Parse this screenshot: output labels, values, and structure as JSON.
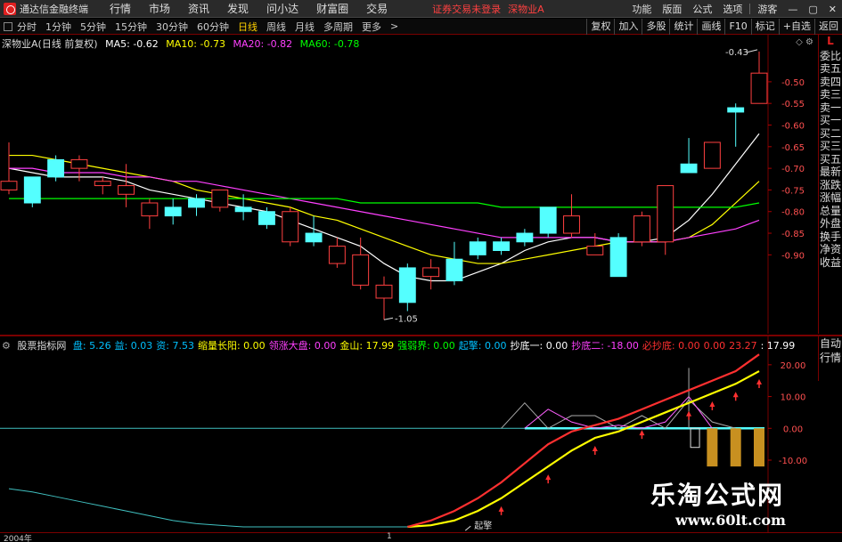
{
  "titlebar": {
    "app_title": "通达信金融终端",
    "menu": [
      "行情",
      "市场",
      "资讯",
      "发现",
      "问小达",
      "财富圈",
      "交易"
    ],
    "notice": "证券交易未登录",
    "stock": "深物业A",
    "right_menu": [
      "功能",
      "版面",
      "公式",
      "选项",
      "游客"
    ]
  },
  "toolbar": {
    "periods": [
      "分时",
      "1分钟",
      "5分钟",
      "15分钟",
      "30分钟",
      "60分钟",
      "日线",
      "周线",
      "月线",
      "多周期",
      "更多"
    ],
    "active_period": "日线",
    "right_buttons": [
      "复权",
      "加入",
      "多股",
      "统计",
      "画线",
      "F10",
      "标记",
      "+自选",
      "返回"
    ]
  },
  "main_legend": {
    "stock_label": "深物业A(日线 前复权)",
    "ma5": "MA5: -0.62",
    "ma10": "MA10: -0.73",
    "ma20": "MA20: -0.82",
    "ma60": "MA60: -0.78",
    "colors": {
      "ma5": "#ffffff",
      "ma10": "#ffff00",
      "ma20": "#ff40ff",
      "ma60": "#00ff00"
    }
  },
  "right_tabs": {
    "top": "L",
    "items": [
      "委比",
      "卖五",
      "卖四",
      "卖三",
      "卖一",
      "买一",
      "买二",
      "买三",
      "买五",
      "最新",
      "涨跌",
      "涨幅",
      "总量",
      "外盘",
      "换手",
      "净资",
      "收益"
    ],
    "sub_items": [
      "自动",
      "行情"
    ]
  },
  "sub_legend": {
    "name": "股票指标网",
    "items": [
      {
        "label": "盘: 5.26",
        "color": "#00c0ff"
      },
      {
        "label": "益: 0.03",
        "color": "#00c0ff"
      },
      {
        "label": "资: 7.53",
        "color": "#00c0ff"
      },
      {
        "label": "缩量长阳: 0.00",
        "color": "#ffff00"
      },
      {
        "label": "领涨大盘: 0.00",
        "color": "#ff40ff"
      },
      {
        "label": "金山: 17.99",
        "color": "#ffff00"
      },
      {
        "label": "强弱界: 0.00",
        "color": "#00ff00"
      },
      {
        "label": "起擎: 0.00",
        "color": "#00c0ff"
      },
      {
        "label": "抄底一: 0.00",
        "color": "#ffffff"
      },
      {
        "label": "抄底二: -18.00",
        "color": "#ff40ff"
      },
      {
        "label": "必抄底: 0.00",
        "color": "#ff3030"
      },
      {
        "label": "0.00",
        "color": "#ff3030"
      },
      {
        "label": "23.27",
        "color": "#ff3030"
      },
      {
        "label": ": 17.99",
        "color": "#ffffff"
      }
    ]
  },
  "chart_data": [
    {
      "type": "candlestick",
      "title": "深物业A(日线 前复权)",
      "y_ticks": [
        -0.5,
        -0.55,
        -0.6,
        -0.65,
        -0.7,
        -0.75,
        -0.8,
        -0.85,
        -0.9
      ],
      "ylim": [
        -1.07,
        -0.42
      ],
      "annotations": [
        {
          "label": "-0.43"
        },
        {
          "label": "-1.05"
        }
      ],
      "candles": [
        {
          "o": -0.75,
          "c": -0.73,
          "h": -0.64,
          "l": -0.76
        },
        {
          "o": -0.72,
          "c": -0.78,
          "h": -0.72,
          "l": -0.79
        },
        {
          "o": -0.68,
          "c": -0.72,
          "h": -0.67,
          "l": -0.73
        },
        {
          "o": -0.7,
          "c": -0.68,
          "h": -0.67,
          "l": -0.73
        },
        {
          "o": -0.74,
          "c": -0.73,
          "h": -0.72,
          "l": -0.76
        },
        {
          "o": -0.76,
          "c": -0.74,
          "h": -0.69,
          "l": -0.79
        },
        {
          "o": -0.81,
          "c": -0.78,
          "h": -0.77,
          "l": -0.84
        },
        {
          "o": -0.79,
          "c": -0.81,
          "h": -0.77,
          "l": -0.83
        },
        {
          "o": -0.77,
          "c": -0.79,
          "h": -0.76,
          "l": -0.81
        },
        {
          "o": -0.79,
          "c": -0.75,
          "h": -0.75,
          "l": -0.8
        },
        {
          "o": -0.79,
          "c": -0.8,
          "h": -0.76,
          "l": -0.82
        },
        {
          "o": -0.8,
          "c": -0.83,
          "h": -0.79,
          "l": -0.84
        },
        {
          "o": -0.87,
          "c": -0.8,
          "h": -0.79,
          "l": -0.88
        },
        {
          "o": -0.85,
          "c": -0.87,
          "h": -0.81,
          "l": -0.88
        },
        {
          "o": -0.92,
          "c": -0.88,
          "h": -0.86,
          "l": -0.93
        },
        {
          "o": -0.97,
          "c": -0.9,
          "h": -0.86,
          "l": -0.98
        },
        {
          "o": -1.0,
          "c": -0.97,
          "h": -0.95,
          "l": -1.05
        },
        {
          "o": -0.93,
          "c": -1.01,
          "h": -0.92,
          "l": -1.03
        },
        {
          "o": -0.95,
          "c": -0.93,
          "h": -0.91,
          "l": -0.98
        },
        {
          "o": -0.91,
          "c": -0.96,
          "h": -0.87,
          "l": -0.97
        },
        {
          "o": -0.87,
          "c": -0.9,
          "h": -0.86,
          "l": -0.91
        },
        {
          "o": -0.87,
          "c": -0.89,
          "h": -0.86,
          "l": -0.9
        },
        {
          "o": -0.85,
          "c": -0.87,
          "h": -0.84,
          "l": -0.88
        },
        {
          "o": -0.79,
          "c": -0.85,
          "h": -0.79,
          "l": -0.86
        },
        {
          "o": -0.85,
          "c": -0.81,
          "h": -0.76,
          "l": -0.86
        },
        {
          "o": -0.9,
          "c": -0.88,
          "h": -0.85,
          "l": -0.9
        },
        {
          "o": -0.86,
          "c": -0.95,
          "h": -0.85,
          "l": -0.95
        },
        {
          "o": -0.87,
          "c": -0.81,
          "h": -0.8,
          "l": -0.88
        },
        {
          "o": -0.87,
          "c": -0.74,
          "h": -0.74,
          "l": -0.9
        },
        {
          "o": -0.69,
          "c": -0.71,
          "h": -0.63,
          "l": -0.71
        },
        {
          "o": -0.7,
          "c": -0.64,
          "h": -0.64,
          "l": -0.7
        },
        {
          "o": -0.56,
          "c": -0.57,
          "h": -0.55,
          "l": -0.65
        },
        {
          "o": -0.55,
          "c": -0.48,
          "h": -0.43,
          "l": -0.55
        }
      ],
      "ma_lines": [
        {
          "name": "MA5",
          "color": "#ffffff",
          "values": [
            -0.7,
            -0.71,
            -0.72,
            -0.72,
            -0.72,
            -0.73,
            -0.75,
            -0.76,
            -0.77,
            -0.78,
            -0.79,
            -0.8,
            -0.82,
            -0.84,
            -0.86,
            -0.88,
            -0.92,
            -0.95,
            -0.96,
            -0.96,
            -0.94,
            -0.92,
            -0.89,
            -0.87,
            -0.86,
            -0.86,
            -0.87,
            -0.87,
            -0.86,
            -0.82,
            -0.76,
            -0.69,
            -0.62
          ]
        },
        {
          "name": "MA10",
          "color": "#ffff00",
          "values": [
            -0.67,
            -0.67,
            -0.68,
            -0.69,
            -0.7,
            -0.71,
            -0.72,
            -0.73,
            -0.75,
            -0.76,
            -0.77,
            -0.78,
            -0.79,
            -0.81,
            -0.82,
            -0.84,
            -0.86,
            -0.88,
            -0.9,
            -0.91,
            -0.92,
            -0.92,
            -0.91,
            -0.9,
            -0.89,
            -0.88,
            -0.87,
            -0.87,
            -0.87,
            -0.86,
            -0.83,
            -0.78,
            -0.73
          ]
        },
        {
          "name": "MA20",
          "color": "#ff40ff",
          "values": [
            -0.7,
            -0.7,
            -0.71,
            -0.71,
            -0.71,
            -0.72,
            -0.72,
            -0.73,
            -0.73,
            -0.74,
            -0.75,
            -0.76,
            -0.77,
            -0.78,
            -0.79,
            -0.8,
            -0.81,
            -0.82,
            -0.83,
            -0.84,
            -0.85,
            -0.86,
            -0.86,
            -0.86,
            -0.86,
            -0.86,
            -0.87,
            -0.87,
            -0.87,
            -0.86,
            -0.85,
            -0.84,
            -0.82
          ]
        },
        {
          "name": "MA60",
          "color": "#00ff00",
          "values": [
            -0.77,
            -0.77,
            -0.77,
            -0.77,
            -0.77,
            -0.77,
            -0.77,
            -0.77,
            -0.77,
            -0.77,
            -0.77,
            -0.77,
            -0.77,
            -0.77,
            -0.77,
            -0.78,
            -0.78,
            -0.78,
            -0.78,
            -0.78,
            -0.78,
            -0.79,
            -0.79,
            -0.79,
            -0.79,
            -0.79,
            -0.79,
            -0.79,
            -0.79,
            -0.79,
            -0.79,
            -0.79,
            -0.78
          ]
        }
      ]
    },
    {
      "type": "line",
      "title": "股票指标网",
      "y_ticks": [
        20,
        10,
        0,
        -10
      ],
      "ylim": [
        -31,
        25
      ],
      "annotations": [
        {
          "label": "起擎"
        }
      ],
      "x_labels": [
        "2004年",
        "1"
      ],
      "series": [
        {
          "name": "金山",
          "color": "#ffff00",
          "values": [
            null,
            null,
            null,
            null,
            null,
            null,
            null,
            null,
            null,
            null,
            null,
            null,
            null,
            null,
            null,
            null,
            null,
            -31,
            -30.5,
            -29,
            -26,
            -22,
            -17,
            -12,
            -7,
            -3,
            -1,
            2,
            5,
            8,
            11,
            14,
            17.99
          ]
        },
        {
          "name": "red",
          "color": "#ff3030",
          "values": [
            null,
            null,
            null,
            null,
            null,
            null,
            null,
            null,
            null,
            null,
            null,
            null,
            null,
            null,
            null,
            null,
            null,
            -31,
            -29,
            -26,
            -22,
            -17,
            -11,
            -5,
            -1,
            1,
            3,
            6,
            9,
            12,
            15,
            18,
            23.27
          ]
        },
        {
          "name": "cyan",
          "color": "#40c0c0",
          "values": [
            -19,
            -20,
            -21.5,
            -23,
            -24.5,
            -26,
            -27.5,
            -29,
            -30,
            -30.5,
            -31,
            -31,
            -31,
            -31,
            -31,
            -31,
            -31,
            -31,
            null,
            null,
            null,
            null,
            null,
            null,
            null,
            null,
            null,
            null,
            null,
            null,
            null,
            null,
            null
          ]
        }
      ],
      "baseline": 0
    }
  ],
  "dates": {
    "start": "2004年",
    "mid": "1"
  },
  "watermark": {
    "line1": "乐淘公式网",
    "line2": "www.60lt.com"
  }
}
